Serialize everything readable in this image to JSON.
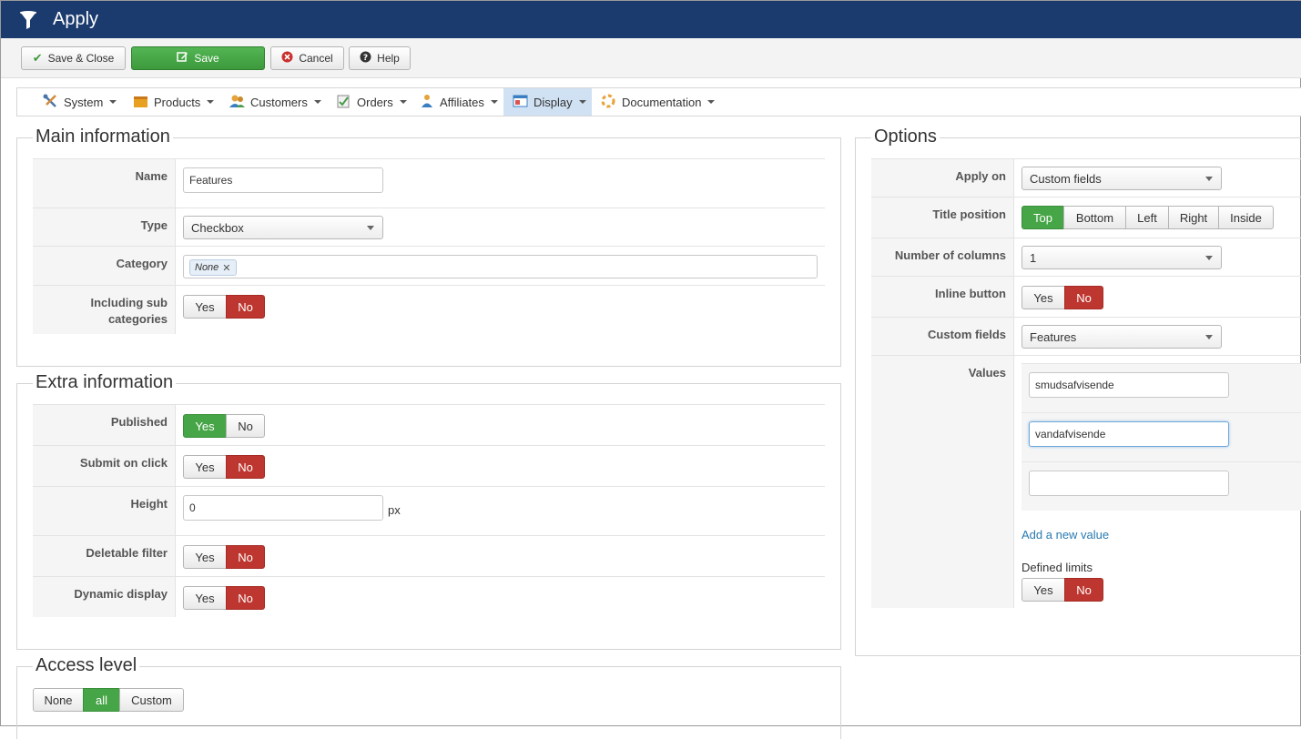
{
  "window": {
    "title": "Apply",
    "title_icon": "filter-icon"
  },
  "toolbar": {
    "save_close": "Save & Close",
    "save": "Save",
    "cancel": "Cancel",
    "help": "Help"
  },
  "menu": {
    "items": [
      {
        "label": "System",
        "icon": "tools-icon"
      },
      {
        "label": "Products",
        "icon": "box-icon"
      },
      {
        "label": "Customers",
        "icon": "users-icon"
      },
      {
        "label": "Orders",
        "icon": "clipboard-icon"
      },
      {
        "label": "Affiliates",
        "icon": "affiliate-icon"
      },
      {
        "label": "Display",
        "icon": "display-icon",
        "active": true
      },
      {
        "label": "Documentation",
        "icon": "help-ring-icon"
      }
    ]
  },
  "main": {
    "legend": "Main information",
    "name_label": "Name",
    "name_value": "Features",
    "type_label": "Type",
    "type_value": "Checkbox",
    "category_label": "Category",
    "category_tag": "None",
    "including_label": "Including sub categories",
    "including_yes": "Yes",
    "including_no": "No",
    "including_selected": "No"
  },
  "extra": {
    "legend": "Extra information",
    "published_label": "Published",
    "published_selected": "Yes",
    "submit_label": "Submit on click",
    "submit_selected": "No",
    "height_label": "Height",
    "height_value": "0",
    "height_unit": "px",
    "deletable_label": "Deletable filter",
    "deletable_selected": "No",
    "dynamic_label": "Dynamic display",
    "dynamic_selected": "No",
    "yes": "Yes",
    "no": "No"
  },
  "access": {
    "legend": "Access level",
    "options": [
      "None",
      "all",
      "Custom"
    ],
    "selected": "all"
  },
  "options": {
    "legend": "Options",
    "apply_on_label": "Apply on",
    "apply_on_value": "Custom fields",
    "title_position_label": "Title position",
    "title_positions": [
      "Top",
      "Bottom",
      "Left",
      "Right",
      "Inside"
    ],
    "title_position_selected": "Top",
    "columns_label": "Number of columns",
    "columns_value": "1",
    "inline_label": "Inline button",
    "inline_selected": "No",
    "custom_fields_label": "Custom fields",
    "custom_fields_value": "Features",
    "values_label": "Values",
    "values": [
      "smudsafvisende",
      "vandafvisende",
      ""
    ],
    "add_value": "Add a new value",
    "defined_limits_label": "Defined limits",
    "defined_limits_selected": "No",
    "yes": "Yes",
    "no": "No"
  }
}
